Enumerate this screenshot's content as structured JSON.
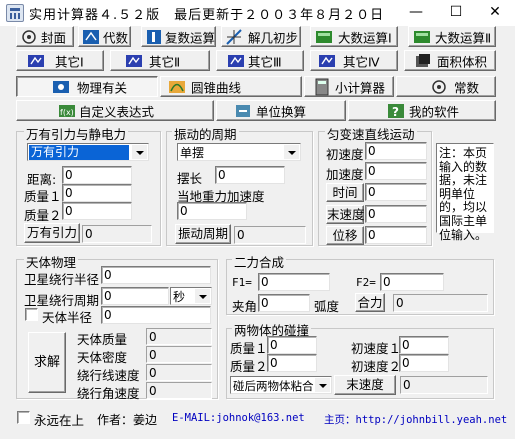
{
  "window": {
    "title": "实用计算器４.５２版　最后更新于２００３年８月２０日",
    "minimize": "—",
    "maximize": "☐",
    "close": "✕"
  },
  "toolbar_row1": [
    {
      "label": "封面",
      "icon": "cover-icon"
    },
    {
      "label": "代数",
      "icon": "algebra-icon"
    },
    {
      "label": "复数运算",
      "icon": "complex-icon"
    },
    {
      "label": "解几初步",
      "icon": "geometry-icon"
    },
    {
      "label": "大数运算Ⅰ",
      "icon": "bignum-icon"
    },
    {
      "label": "大数运算Ⅱ",
      "icon": "bignum-icon"
    }
  ],
  "toolbar_row2": [
    {
      "label": "其它Ⅰ",
      "icon": "misc-icon"
    },
    {
      "label": "其它Ⅱ",
      "icon": "misc-icon"
    },
    {
      "label": "其它Ⅲ",
      "icon": "misc-icon"
    },
    {
      "label": "其它Ⅳ",
      "icon": "misc-icon"
    },
    {
      "label": "面积体积",
      "icon": "area-volume-icon"
    }
  ],
  "toolbar_row3": [
    {
      "label": "物理有关",
      "icon": "physics-icon",
      "active": true
    },
    {
      "label": "圆锥曲线",
      "icon": "conic-icon"
    },
    {
      "label": "小计算器",
      "icon": "calculator-icon"
    },
    {
      "label": "常数",
      "icon": "constants-icon"
    }
  ],
  "toolbar_row4": [
    {
      "label": "自定义表达式",
      "icon": "expression-icon"
    },
    {
      "label": "单位换算",
      "icon": "unit-convert-icon"
    },
    {
      "label": "我的软件",
      "icon": "help-icon"
    }
  ],
  "gravity": {
    "title": "万有引力与静电力",
    "mode": "万有引力",
    "distance_label": "距离:",
    "distance": "0",
    "mass1_label": "质量１",
    "mass1": "0",
    "mass2_label": "质量２",
    "mass2": "0",
    "button": "万有引力",
    "result": "0"
  },
  "period": {
    "title": "振动的周期",
    "mode": "单摆",
    "length_label": "摆长",
    "length": "0",
    "g_label": "当地重力加速度",
    "g": "0",
    "button": "振动周期",
    "result": "0"
  },
  "motion": {
    "title": "匀变速直线运动",
    "v0_label": "初速度",
    "v0": "0",
    "a_label": "加速度",
    "a": "0",
    "t_label": "时间",
    "t": "0",
    "v_label": "末速度",
    "v": "0",
    "s_label": "位移",
    "s": "0"
  },
  "note": "注：本页输入的数据，未注明单位的，均以国际主单位输入。",
  "celestial": {
    "title": "天体物理",
    "radius_label": "卫星绕行半径",
    "radius": "0",
    "period_label": "卫星绕行周期",
    "period": "0",
    "period_unit": "秒",
    "body_radius_label": "天体半径",
    "body_radius": "0",
    "solve": "求解",
    "mass_label": "天体质量",
    "mass": "0",
    "density_label": "天体密度",
    "density": "0",
    "linear_speed_label": "绕行线速度",
    "linear_speed": "0",
    "angular_speed_label": "绕行角速度",
    "angular_speed": "0"
  },
  "force": {
    "title": "二力合成",
    "f1_label": "F1=",
    "f1": "0",
    "f2_label": "F2=",
    "f2": "0",
    "angle_label": "夹角",
    "angle": "0",
    "angle_unit": "弧度",
    "button": "合力",
    "result": "0"
  },
  "collision": {
    "title": "两物体的碰撞",
    "m1_label": "质量１",
    "m1": "0",
    "m2_label": "质量２",
    "m2": "0",
    "v1_label": "初速度１",
    "v1": "0",
    "v2_label": "初速度２",
    "v2": "0",
    "mode": "碰后两物体粘合",
    "button": "末速度",
    "result": "0"
  },
  "footer": {
    "always_on_top": "永远在上",
    "author": "作者：姜边",
    "email": "E-MAIL:johnok@163.net",
    "homepage": "主页：http://johnbill.yeah.net"
  }
}
